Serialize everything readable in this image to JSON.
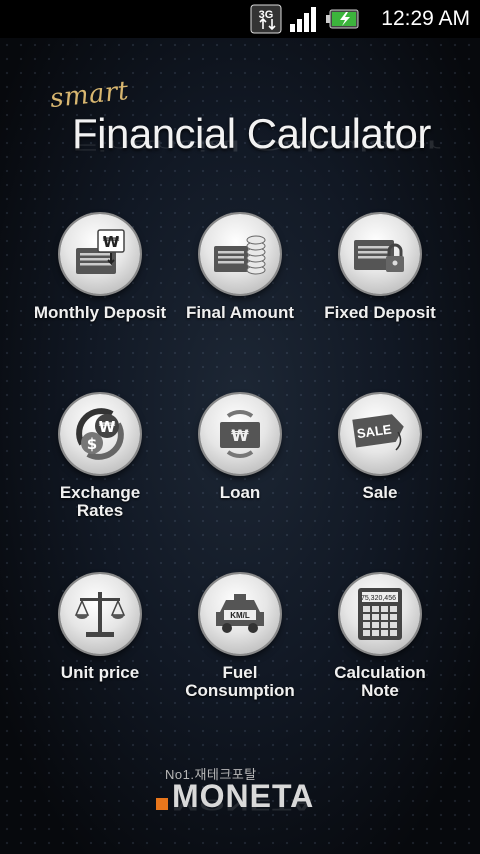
{
  "status_bar": {
    "network_label": "3G",
    "time": "12:29 AM"
  },
  "header": {
    "subtitle": "smart",
    "title": "Financial Calculator"
  },
  "menu": [
    {
      "label": "Monthly Deposit",
      "icon": "monthly-deposit-icon"
    },
    {
      "label": "Final Amount",
      "icon": "final-amount-icon"
    },
    {
      "label": "Fixed Deposit",
      "icon": "fixed-deposit-icon"
    },
    {
      "label": "Exchange\nRates",
      "icon": "exchange-rates-icon"
    },
    {
      "label": "Loan",
      "icon": "loan-icon"
    },
    {
      "label": "Sale",
      "icon": "sale-icon"
    },
    {
      "label": "Unit price",
      "icon": "unit-price-icon"
    },
    {
      "label": "Fuel\nConsumption",
      "icon": "fuel-consumption-icon"
    },
    {
      "label": "Calculation\nNote",
      "icon": "calculation-note-icon"
    }
  ],
  "icon_text": {
    "won": "₩",
    "sale": "SALE",
    "kml": "KM/L",
    "calc_display": "75,320,456"
  },
  "footer": {
    "tagline": "No1.재테크포탈",
    "brand": "MONETA"
  },
  "colors": {
    "accent_gold": "#d9b770",
    "brand_orange": "#e8761c"
  }
}
